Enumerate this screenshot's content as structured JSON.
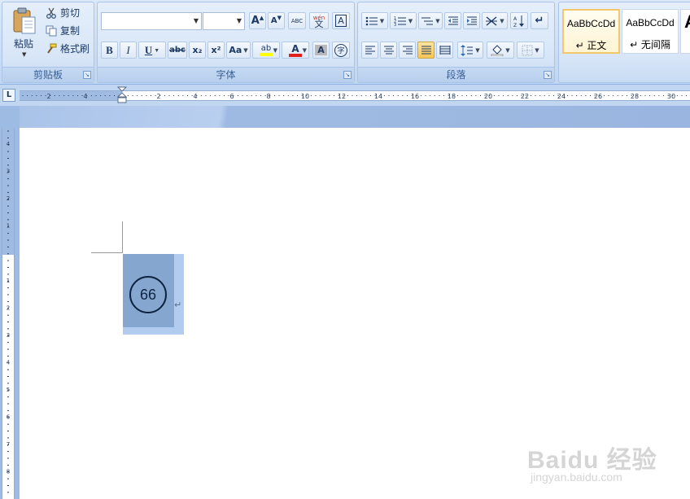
{
  "clipboard": {
    "paste_label": "粘贴",
    "cut_label": "剪切",
    "copy_label": "复制",
    "format_painter_label": "格式刷",
    "group_label": "剪贴板"
  },
  "font": {
    "group_label": "字体",
    "font_name": "",
    "font_size": "",
    "grow_label": "A",
    "shrink_label": "A",
    "clear_format_label": "ABC",
    "phonetic_label": "wén",
    "phonetic_char": "文",
    "border_label": "A",
    "bold_label": "B",
    "italic_label": "I",
    "underline_label": "U",
    "strike_label": "abc",
    "subscript_label": "x₂",
    "superscript_label": "x²",
    "case_label": "Aa",
    "highlight_label": "ab",
    "font_color_label": "A",
    "shading_label": "A",
    "enclose_label": "字"
  },
  "paragraph": {
    "group_label": "段落"
  },
  "styles": {
    "items": [
      {
        "sample": "AaBbCcDd",
        "name": "↵ 正文"
      },
      {
        "sample": "AaBbCcDd",
        "name": "↵ 无间隔"
      },
      {
        "sample": "A",
        "name": ""
      }
    ]
  },
  "ruler": {
    "tab_selector": "L",
    "h_left_ticks": [
      "4",
      "2"
    ],
    "h_ticks": [
      "2",
      "4",
      "6",
      "8",
      "10",
      "12",
      "14",
      "16",
      "18",
      "20",
      "22",
      "24",
      "26",
      "28",
      "30"
    ],
    "v_top_ticks": [
      "4",
      "3",
      "2",
      "1"
    ],
    "v_ticks": [
      "1",
      "2",
      "3",
      "4",
      "5",
      "6",
      "7",
      "8"
    ]
  },
  "document": {
    "circle_number": "66",
    "paragraph_mark": "↵"
  },
  "watermark": {
    "main": "Baidu 经验",
    "sub": "jingyan.baidu.com"
  },
  "colors": {
    "highlight": "#ffff00",
    "font_color": "#e0201b",
    "selection": "#b1ccef",
    "cell": "#85a7cf"
  }
}
